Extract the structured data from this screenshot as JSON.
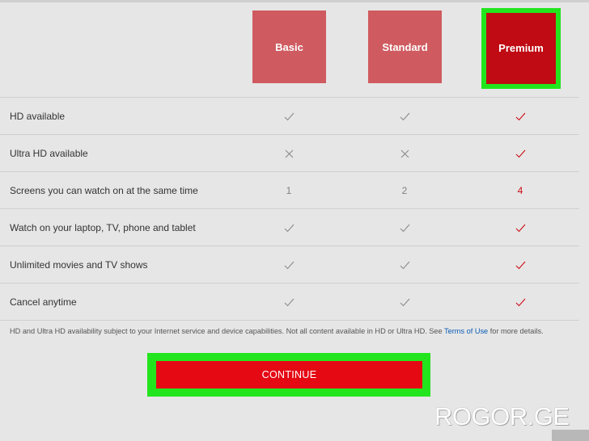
{
  "plans": [
    {
      "name": "Basic",
      "selected": false
    },
    {
      "name": "Standard",
      "selected": false
    },
    {
      "name": "Premium",
      "selected": true
    }
  ],
  "features": [
    {
      "label": "HD available",
      "values": [
        "check",
        "check",
        "check"
      ]
    },
    {
      "label": "Ultra HD available",
      "values": [
        "cross",
        "cross",
        "check"
      ]
    },
    {
      "label": "Screens you can watch on at the same time",
      "values": [
        "1",
        "2",
        "4"
      ]
    },
    {
      "label": "Watch on your laptop, TV, phone and tablet",
      "values": [
        "check",
        "check",
        "check"
      ]
    },
    {
      "label": "Unlimited movies and TV shows",
      "values": [
        "check",
        "check",
        "check"
      ]
    },
    {
      "label": "Cancel anytime",
      "values": [
        "check",
        "check",
        "check"
      ]
    }
  ],
  "disclaimer": {
    "text_before": "HD and Ultra HD availability subject to your Internet service and device capabilities. Not all content available in HD or Ultra HD. See ",
    "link": "Terms of Use",
    "text_after": " for more details."
  },
  "cta": {
    "label": "CONTINUE"
  },
  "watermark": "ROGOR.GE",
  "colors": {
    "plan_unselected": "#cf5b60",
    "plan_selected": "#c00b14",
    "highlight": "#23e51d",
    "cta": "#e50914",
    "link": "#0a5bb5"
  },
  "icons": {
    "check": "check-icon",
    "cross": "cross-icon"
  }
}
